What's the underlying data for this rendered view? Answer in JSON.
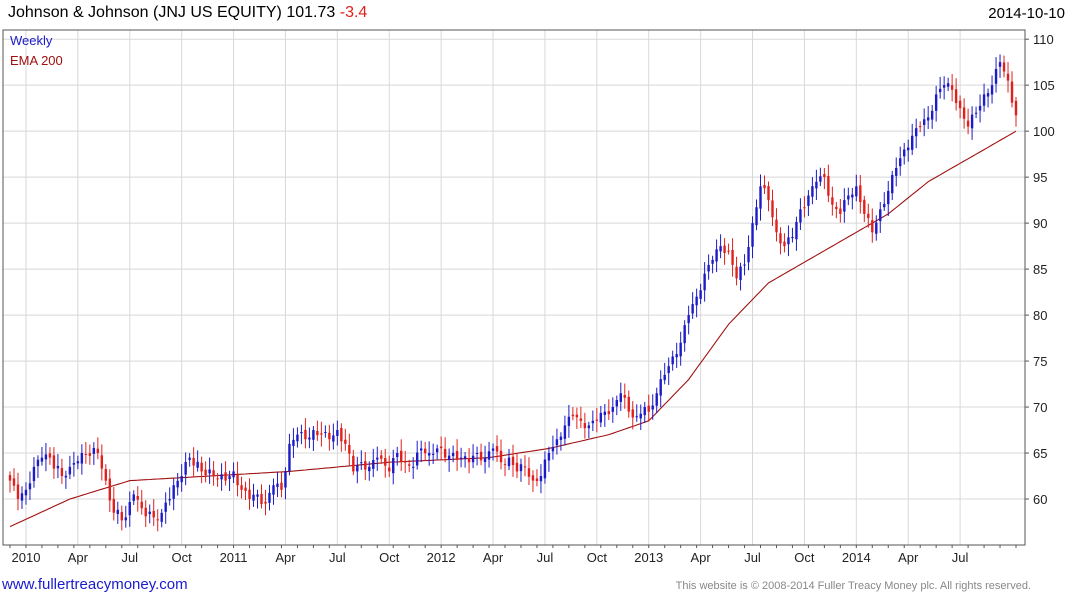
{
  "header": {
    "title": "Johnson & Johnson (JNJ US EQUITY)",
    "last": "101.73",
    "change": "-3.4",
    "date": "2014-10-10"
  },
  "footer": {
    "link": "www.fullertreacymoney.com",
    "copyright": "This website is © 2008-2014 Fuller Treacy Money plc. All rights reserved."
  },
  "colors": {
    "up": "#1b1bc8",
    "down": "#e0201c",
    "ema": "#a01010",
    "grid": "#d8d8d8"
  },
  "chart_data": {
    "type": "candlestick",
    "frequency": "Weekly",
    "legend": [
      {
        "name": "Weekly",
        "color": "#1b1bc8"
      },
      {
        "name": "EMA 200",
        "color": "#a01010"
      }
    ],
    "legend_position": "top-left",
    "ylim": [
      55,
      111
    ],
    "y_ticks": [
      60,
      65,
      70,
      75,
      80,
      85,
      90,
      95,
      100,
      105,
      110
    ],
    "y_axis_side": "right",
    "grid": true,
    "x_ticks": [
      "2010",
      "Apr",
      "Jul",
      "Oct",
      "2011",
      "Apr",
      "Jul",
      "Oct",
      "2012",
      "Apr",
      "Jul",
      "Oct",
      "2013",
      "Apr",
      "Jul",
      "Oct",
      "2014",
      "Apr",
      "Jul"
    ],
    "x_tick_weeks": [
      4,
      17,
      30,
      43,
      56,
      69,
      82,
      95,
      108,
      121,
      134,
      147,
      160,
      173,
      186,
      199,
      212,
      225,
      238
    ],
    "num_weeks": 253,
    "close_anchors": [
      [
        0,
        62.0
      ],
      [
        2,
        60.0
      ],
      [
        4,
        61.0
      ],
      [
        6,
        63.5
      ],
      [
        8,
        64.5
      ],
      [
        10,
        64.5
      ],
      [
        13,
        62.5
      ],
      [
        15,
        63.5
      ],
      [
        18,
        65.0
      ],
      [
        22,
        65.0
      ],
      [
        24,
        62.0
      ],
      [
        26,
        58.5
      ],
      [
        29,
        58.0
      ],
      [
        31,
        60.5
      ],
      [
        33,
        59.0
      ],
      [
        36,
        58.0
      ],
      [
        38,
        58.5
      ],
      [
        41,
        61.5
      ],
      [
        43,
        62.5
      ],
      [
        45,
        64.5
      ],
      [
        48,
        63.0
      ],
      [
        51,
        62.5
      ],
      [
        54,
        62.0
      ],
      [
        56,
        63.0
      ],
      [
        58,
        61.0
      ],
      [
        60,
        60.0
      ],
      [
        62,
        60.5
      ],
      [
        64,
        59.5
      ],
      [
        66,
        61.5
      ],
      [
        68,
        61.0
      ],
      [
        70,
        66.0
      ],
      [
        72,
        67.0
      ],
      [
        74,
        66.5
      ],
      [
        76,
        67.5
      ],
      [
        78,
        67.0
      ],
      [
        80,
        66.5
      ],
      [
        82,
        67.5
      ],
      [
        84,
        66.0
      ],
      [
        86,
        63.0
      ],
      [
        88,
        64.0
      ],
      [
        90,
        63.5
      ],
      [
        92,
        64.5
      ],
      [
        95,
        63.0
      ],
      [
        97,
        65.0
      ],
      [
        99,
        64.0
      ],
      [
        101,
        63.5
      ],
      [
        103,
        65.5
      ],
      [
        105,
        65.0
      ],
      [
        107,
        65.5
      ],
      [
        109,
        64.5
      ],
      [
        111,
        65.0
      ],
      [
        113,
        64.5
      ],
      [
        115,
        64.0
      ],
      [
        117,
        65.0
      ],
      [
        119,
        64.5
      ],
      [
        121,
        65.5
      ],
      [
        123,
        64.0
      ],
      [
        125,
        64.5
      ],
      [
        127,
        63.0
      ],
      [
        129,
        63.5
      ],
      [
        131,
        62.0
      ],
      [
        133,
        62.5
      ],
      [
        135,
        65.0
      ],
      [
        137,
        66.5
      ],
      [
        139,
        68.0
      ],
      [
        141,
        69.0
      ],
      [
        143,
        68.5
      ],
      [
        145,
        68.0
      ],
      [
        147,
        68.5
      ],
      [
        149,
        69.5
      ],
      [
        151,
        70.0
      ],
      [
        153,
        71.5
      ],
      [
        155,
        69.5
      ],
      [
        157,
        69.0
      ],
      [
        159,
        70.0
      ],
      [
        160,
        69.5
      ],
      [
        162,
        71.5
      ],
      [
        164,
        73.5
      ],
      [
        166,
        75.5
      ],
      [
        168,
        77.0
      ],
      [
        170,
        80.0
      ],
      [
        172,
        82.0
      ],
      [
        174,
        84.5
      ],
      [
        176,
        86.0
      ],
      [
        178,
        87.5
      ],
      [
        180,
        87.0
      ],
      [
        182,
        84.0
      ],
      [
        184,
        85.5
      ],
      [
        186,
        90.0
      ],
      [
        188,
        94.0
      ],
      [
        190,
        92.5
      ],
      [
        192,
        89.0
      ],
      [
        194,
        87.5
      ],
      [
        196,
        88.5
      ],
      [
        198,
        91.5
      ],
      [
        200,
        93.0
      ],
      [
        202,
        94.5
      ],
      [
        204,
        95.0
      ],
      [
        206,
        92.0
      ],
      [
        208,
        91.0
      ],
      [
        210,
        93.0
      ],
      [
        212,
        94.0
      ],
      [
        214,
        91.0
      ],
      [
        216,
        89.0
      ],
      [
        218,
        91.5
      ],
      [
        220,
        93.5
      ],
      [
        222,
        96.0
      ],
      [
        224,
        98.0
      ],
      [
        226,
        99.5
      ],
      [
        228,
        100.5
      ],
      [
        230,
        101.5
      ],
      [
        232,
        104.0
      ],
      [
        234,
        105.0
      ],
      [
        236,
        104.5
      ],
      [
        238,
        102.5
      ],
      [
        240,
        100.5
      ],
      [
        242,
        102.0
      ],
      [
        244,
        104.0
      ],
      [
        246,
        105.0
      ],
      [
        248,
        107.5
      ],
      [
        250,
        105.5
      ],
      [
        252,
        101.73
      ]
    ],
    "ema_anchors": [
      [
        0,
        57.0
      ],
      [
        15,
        60.0
      ],
      [
        30,
        62.0
      ],
      [
        50,
        62.5
      ],
      [
        70,
        63.0
      ],
      [
        95,
        64.0
      ],
      [
        120,
        64.5
      ],
      [
        135,
        65.5
      ],
      [
        150,
        67.0
      ],
      [
        160,
        68.5
      ],
      [
        170,
        73.0
      ],
      [
        180,
        79.0
      ],
      [
        190,
        83.5
      ],
      [
        200,
        86.0
      ],
      [
        210,
        88.5
      ],
      [
        220,
        91.0
      ],
      [
        230,
        94.5
      ],
      [
        240,
        97.0
      ],
      [
        252,
        100.0
      ]
    ]
  }
}
